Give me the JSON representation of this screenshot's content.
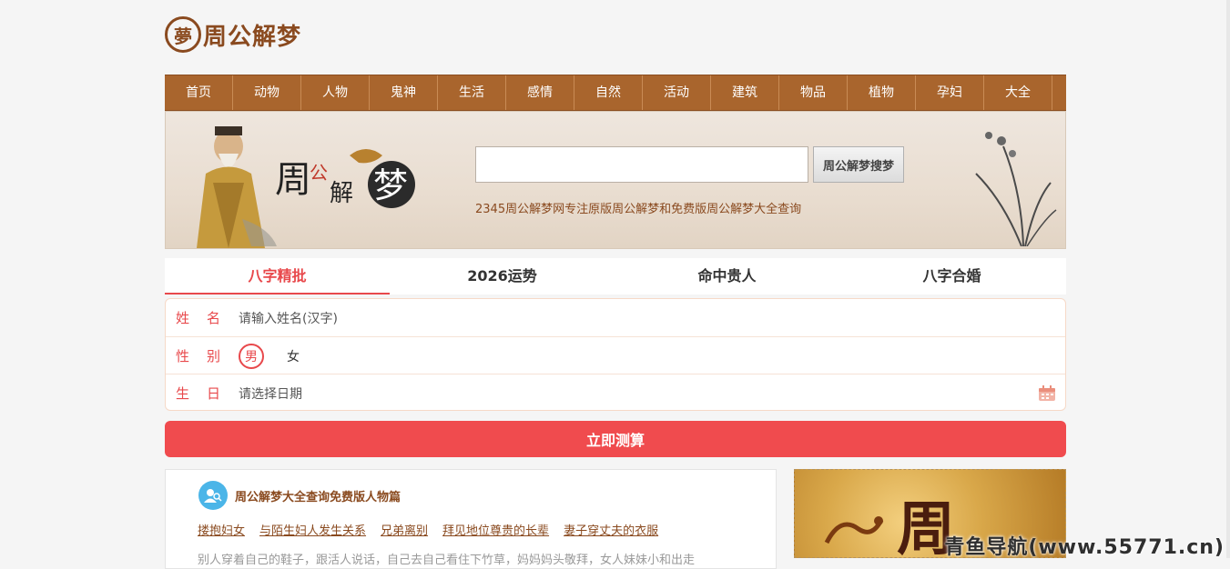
{
  "logo": {
    "seal": "夢",
    "text": "周公解梦"
  },
  "nav": [
    "首页",
    "动物",
    "人物",
    "鬼神",
    "生活",
    "感情",
    "自然",
    "活动",
    "建筑",
    "物品",
    "植物",
    "孕妇",
    "大全"
  ],
  "banner": {
    "title_chars": [
      "周",
      "公",
      "解",
      "梦"
    ],
    "search_button": "周公解梦搜梦",
    "search_value": "",
    "description": "2345周公解梦网专注原版周公解梦和免费版周公解梦大全查询"
  },
  "tabs": [
    "八字精批",
    "2026运势",
    "命中贵人",
    "八字合婚"
  ],
  "form": {
    "name_label_a": "姓",
    "name_label_b": "名",
    "name_placeholder": "请输入姓名(汉字)",
    "gender_label_a": "性",
    "gender_label_b": "别",
    "gender_male": "男",
    "gender_female": "女",
    "birth_label_a": "生",
    "birth_label_b": "日",
    "birth_placeholder": "请选择日期",
    "submit": "立即测算"
  },
  "card": {
    "title": "周公解梦大全查询免费版人物篇",
    "links": [
      "搂抱妇女",
      "与陌生妇人发生关系",
      "兄弟离别",
      "拜见地位尊贵的长辈",
      "妻子穿丈夫的衣服"
    ],
    "cut_text": "别人穿着自己的鞋子，跟活人说话，自己去自己看住下竹草，妈妈妈头敬拜，女人妹妹小和出走"
  },
  "ad": {
    "char": "周"
  },
  "watermark": "青鱼导航(www.55771.cn)",
  "colors": {
    "nav_bg": "#a9652d",
    "accent_red": "#e8484b",
    "brand_brown": "#8a4a1f"
  }
}
